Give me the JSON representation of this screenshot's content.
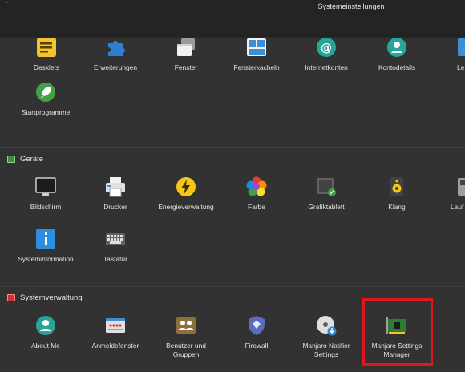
{
  "window": {
    "title": "Systemeinstellungen"
  },
  "top_row": [
    {
      "label": "Desklets",
      "icon": "desklets-icon"
    },
    {
      "label": "Erweiterungen",
      "icon": "puzzle-icon"
    },
    {
      "label": "Fenster",
      "icon": "windows-icon"
    },
    {
      "label": "Fensterkacheln",
      "icon": "tiles-icon"
    },
    {
      "label": "Internetkonten",
      "icon": "at-icon"
    },
    {
      "label": "Kontodetails",
      "icon": "account-icon"
    },
    {
      "label": "Le",
      "icon": "cut-off-icon"
    }
  ],
  "startprogramme": {
    "label": "Startprogramme",
    "icon": "rocket-icon"
  },
  "sections": {
    "geraete": {
      "title": "Geräte"
    },
    "systemverwaltung": {
      "title": "Systemverwaltung"
    }
  },
  "geraete_row1": [
    {
      "label": "Bildschirm"
    },
    {
      "label": "Drucker"
    },
    {
      "label": "Energieverwaltung"
    },
    {
      "label": "Farbe"
    },
    {
      "label": "Grafiktablett"
    },
    {
      "label": "Klang"
    },
    {
      "label": "Lauf"
    }
  ],
  "geraete_row2": [
    {
      "label": "Systeminformation"
    },
    {
      "label": "Tastatur"
    }
  ],
  "systemverwaltung_row": [
    {
      "label": "About Me"
    },
    {
      "label": "Anmeldefenster"
    },
    {
      "label_line1": "Benutzer und",
      "label_line2": "Gruppen"
    },
    {
      "label": "Firewall"
    },
    {
      "label_line1": "Manjaro Notifier",
      "label_line2": "Settings"
    },
    {
      "label_line1": "Manjaro Settings",
      "label_line2": "Manager"
    }
  ],
  "colors": {
    "accent_highlight": "#e0161c",
    "background": "#323232",
    "titlebar": "#242424"
  }
}
